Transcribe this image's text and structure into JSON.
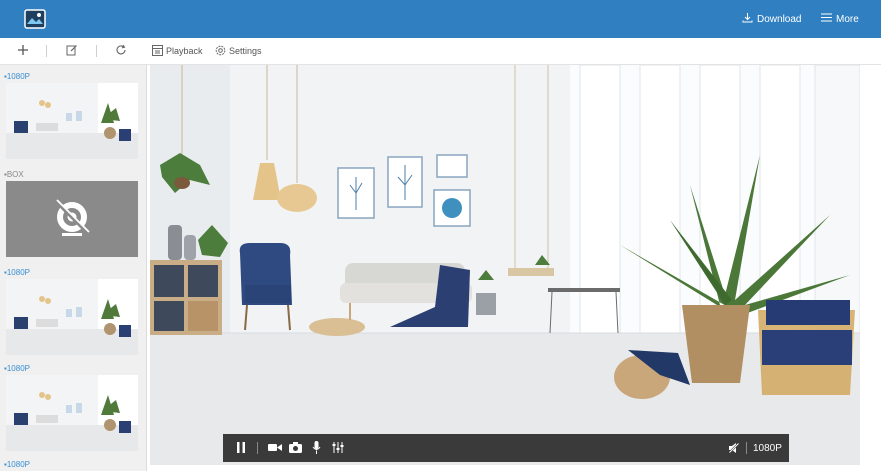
{
  "header": {
    "download_label": "Download",
    "more_label": "More",
    "brand_color": "#2f7fc1"
  },
  "toolbar": {
    "playback_label": "Playback",
    "settings_label": "Settings"
  },
  "sidebar": {
    "cameras": [
      {
        "label": "1080P",
        "status": "online"
      },
      {
        "label": "BOX",
        "status": "offline"
      },
      {
        "label": "1080P",
        "status": "online"
      },
      {
        "label": "1080P",
        "status": "online"
      },
      {
        "label": "1080P",
        "status": "online"
      }
    ]
  },
  "player": {
    "resolution_label": "1080P"
  }
}
